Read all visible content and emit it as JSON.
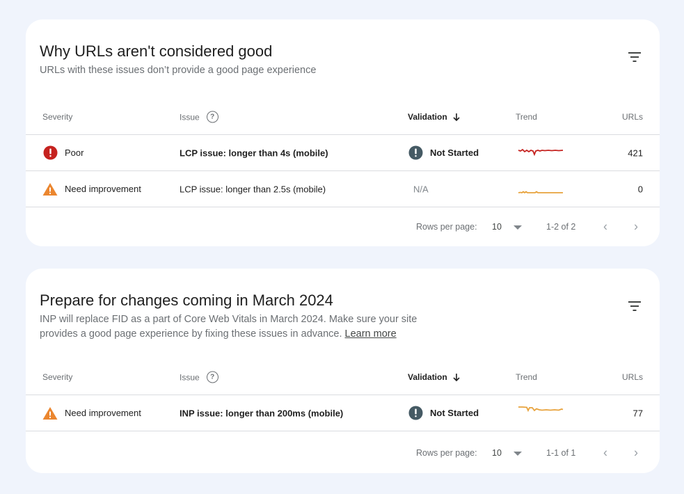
{
  "sections": [
    {
      "title": "Why URLs aren't considered good",
      "subtitle": "URLs with these issues don’t provide a good page experience",
      "learn_more": null,
      "columns": {
        "severity": "Severity",
        "issue": "Issue",
        "validation": "Validation",
        "trend": "Trend",
        "urls": "URLs"
      },
      "rows": [
        {
          "severity": "Poor",
          "severity_icon": "error-icon",
          "issue": "LCP issue: longer than 4s (mobile)",
          "validation": "Not Started",
          "urls": "421",
          "trend_color": "#c5221f"
        },
        {
          "severity": "Need improvement",
          "severity_icon": "warning-icon",
          "issue": "LCP issue: longer than 2.5s (mobile)",
          "validation": "N/A",
          "urls": "0",
          "trend_color": "#e37400"
        }
      ],
      "pager": {
        "rows_per_page_label": "Rows per page:",
        "rows_per_page": "10",
        "range": "1-2 of 2"
      }
    },
    {
      "title": "Prepare for changes coming in March 2024",
      "subtitle": "INP will replace FID as a part of Core Web Vitals in March 2024. Make sure your site provides a good page experience by fixing these issues in advance.",
      "learn_more": "Learn more",
      "columns": {
        "severity": "Severity",
        "issue": "Issue",
        "validation": "Validation",
        "trend": "Trend",
        "urls": "URLs"
      },
      "rows": [
        {
          "severity": "Need improvement",
          "severity_icon": "warning-icon",
          "issue": "INP issue: longer than 200ms (mobile)",
          "validation": "Not Started",
          "urls": "77",
          "trend_color": "#e37400"
        }
      ],
      "pager": {
        "rows_per_page_label": "Rows per page:",
        "rows_per_page": "10",
        "range": "1-1 of 1"
      }
    }
  ],
  "colors": {
    "poor": "#c5221f",
    "warning": "#e8710a",
    "validation_icon": "#455a64",
    "page_bg": "#f0f4fc"
  }
}
